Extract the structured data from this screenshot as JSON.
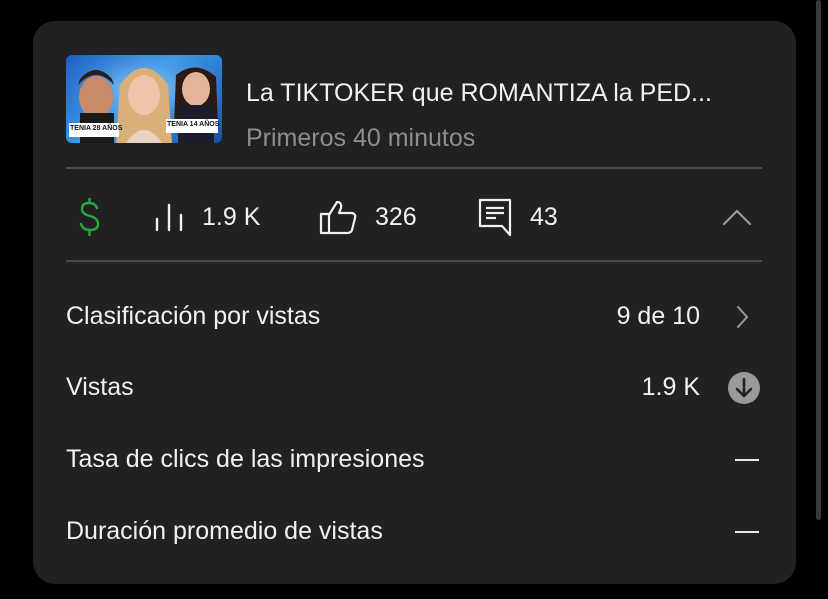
{
  "video": {
    "title": "La TIKTOKER que ROMANTIZA la PED...",
    "subtitle": "Primeros 40 minutos",
    "thumbnail": {
      "left_tag": "TENIA 28 AÑOS",
      "right_tag": "TENIA 14 AÑOS"
    }
  },
  "stats": {
    "monetization_icon": "dollar-icon",
    "monetization_color": "#2ba640",
    "views_icon": "bar-chart-icon",
    "views": "1.9 K",
    "likes_icon": "thumbs-up-icon",
    "likes": "326",
    "comments_icon": "comment-icon",
    "comments": "43",
    "collapse_icon": "chevron-up-icon"
  },
  "metrics": [
    {
      "label": "Clasificación por vistas",
      "value": "9 de 10",
      "icon": "chevron-right-icon"
    },
    {
      "label": "Vistas",
      "value": "1.9 K",
      "icon": "arrow-down-circle-icon"
    },
    {
      "label": "Tasa de clics de las impresiones",
      "value": "—"
    },
    {
      "label": "Duración promedio de vistas",
      "value": "—"
    }
  ]
}
